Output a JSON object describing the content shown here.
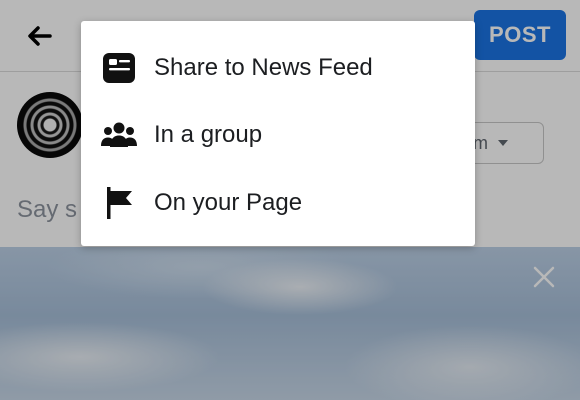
{
  "header": {
    "back_icon": "arrow-left-icon",
    "post_label": "POST",
    "post_color": "#1b74e4"
  },
  "composer": {
    "album_label": "bum",
    "placeholder": "Say s"
  },
  "photo": {
    "remove_icon": "close-icon"
  },
  "share_menu": {
    "items": [
      {
        "label": "Share to News Feed",
        "icon": "news-feed-icon"
      },
      {
        "label": "In a group",
        "icon": "group-icon"
      },
      {
        "label": "On your Page",
        "icon": "flag-icon"
      }
    ]
  }
}
